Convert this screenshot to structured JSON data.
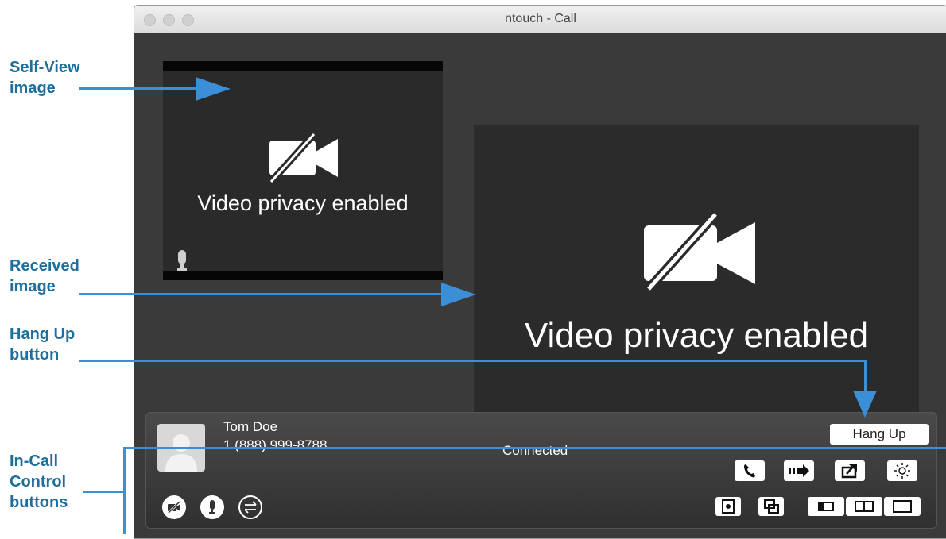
{
  "window": {
    "title": "ntouch - Call"
  },
  "self_view": {
    "privacy_text": "Video privacy enabled"
  },
  "received_view": {
    "privacy_text": "Video privacy enabled"
  },
  "caller": {
    "name": "Tom Doe",
    "number": "1 (888) 999-8788",
    "status": "Connected"
  },
  "controls": {
    "hang_up_label": "Hang Up"
  },
  "callouts": {
    "self_view": "Self-View image",
    "received": "Received image",
    "hang_up": "Hang Up button",
    "in_call": "In-Call Control buttons"
  },
  "colors": {
    "callout": "#1f6f9c",
    "arrow": "#3a8fd6",
    "window_bg": "#3a3a3a"
  }
}
